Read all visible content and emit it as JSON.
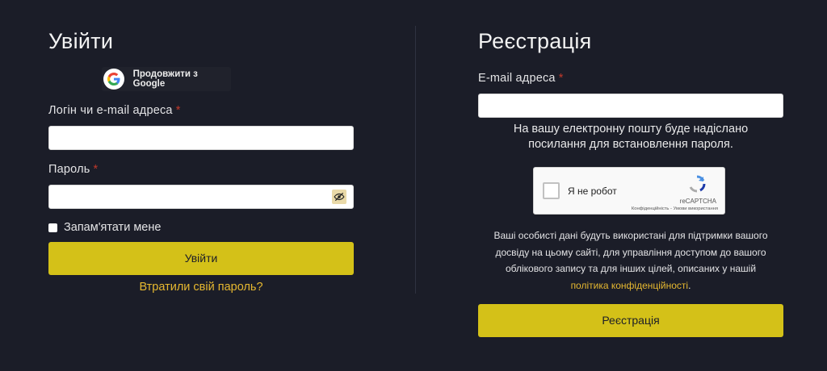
{
  "login": {
    "title": "Увійти",
    "google_label": "Продовжити з Google",
    "username_label": "Логін чи e-mail адреса",
    "username_value": "",
    "password_label": "Пароль",
    "password_value": "",
    "required_mark": "*",
    "remember_label": "Запам'ятати мене",
    "submit_label": "Увійти",
    "lost_password": "Втратили свій пароль?",
    "eye_icon": "eye-slash-icon"
  },
  "register": {
    "title": "Реєстрація",
    "email_label": "E-mail адреса",
    "email_value": "",
    "required_mark": "*",
    "email_note_line1": "На вашу електронну пошту буде надіслано",
    "email_note_line2": "посилання для встановлення пароля.",
    "captcha": {
      "label": "Я не робот",
      "brand": "reCAPTCHA",
      "legal": "Конфіденційність - Умови використання"
    },
    "privacy_line1": "Ваші особисті дані будуть використані для підтримки вашого",
    "privacy_line2": "досвіду на цьому сайті, для управління доступом до вашого",
    "privacy_line3": "облікового запису та для інших цілей, описаних у нашій",
    "privacy_link": "політика конфіденційності",
    "privacy_end": ".",
    "submit_label": "Реєстрація"
  },
  "colors": {
    "background": "#1b1d28",
    "accent_button": "#d4c118",
    "link": "#e6b830",
    "required": "#c0392b"
  }
}
